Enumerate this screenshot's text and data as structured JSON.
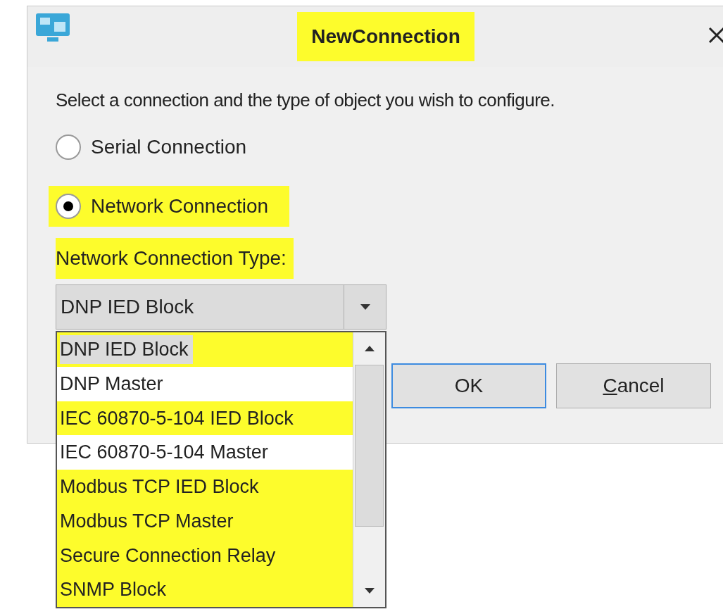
{
  "window": {
    "title": "NewConnection",
    "title_highlighted": true
  },
  "instruction": "Select a connection and the type of object you wish to configure.",
  "radios": [
    {
      "label": "Serial Connection",
      "selected": false,
      "highlighted": false
    },
    {
      "label": "Network Connection",
      "selected": true,
      "highlighted": true
    }
  ],
  "type_label": {
    "text": "Network Connection Type:",
    "highlighted": true
  },
  "combo": {
    "value": "DNP IED Block"
  },
  "dropdown_items": [
    {
      "label": "DNP IED Block",
      "selected": true,
      "highlighted": true
    },
    {
      "label": "DNP Master",
      "selected": false,
      "highlighted": false
    },
    {
      "label": "IEC 60870-5-104 IED Block",
      "selected": false,
      "highlighted": true
    },
    {
      "label": "IEC 60870-5-104 Master",
      "selected": false,
      "highlighted": false
    },
    {
      "label": "Modbus TCP IED Block",
      "selected": false,
      "highlighted": true
    },
    {
      "label": "Modbus TCP Master",
      "selected": false,
      "highlighted": true
    },
    {
      "label": "Secure Connection Relay",
      "selected": false,
      "highlighted": true
    },
    {
      "label": "SNMP Block",
      "selected": false,
      "highlighted": true
    }
  ],
  "buttons": [
    {
      "label": "OK",
      "default": true,
      "mnemonic": false
    },
    {
      "label": "Cancel",
      "default": false,
      "mnemonic": true
    }
  ]
}
